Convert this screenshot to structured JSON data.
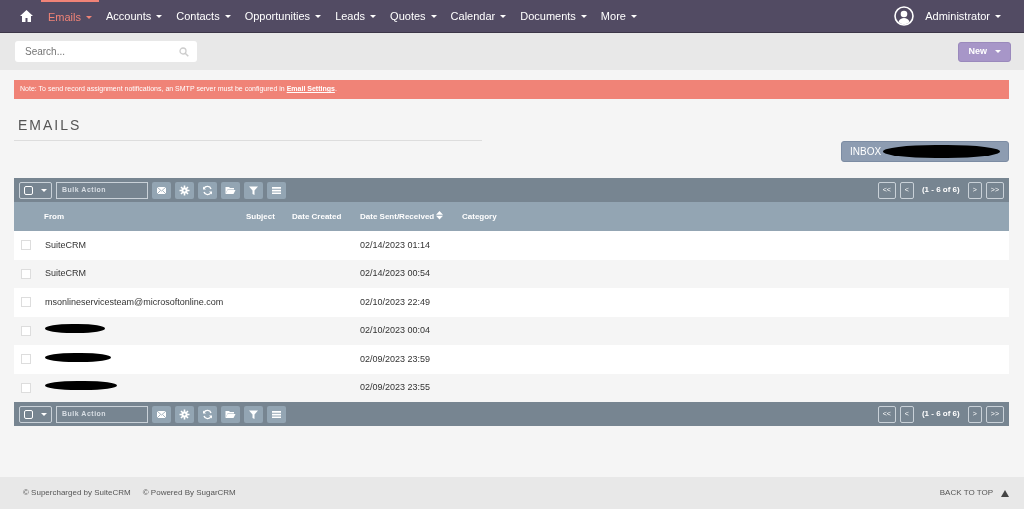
{
  "nav": {
    "items": [
      {
        "label": "Emails",
        "selected": true
      },
      {
        "label": "Accounts",
        "selected": false
      },
      {
        "label": "Contacts",
        "selected": false
      },
      {
        "label": "Opportunities",
        "selected": false
      },
      {
        "label": "Leads",
        "selected": false
      },
      {
        "label": "Quotes",
        "selected": false
      },
      {
        "label": "Calendar",
        "selected": false
      },
      {
        "label": "Documents",
        "selected": false
      },
      {
        "label": "More",
        "selected": false
      }
    ],
    "user": "Administrator"
  },
  "search": {
    "placeholder": "Search..."
  },
  "new_button": "New",
  "alert": {
    "text": "Note: To send record assignment notifications, an SMTP server must be configured in",
    "link": "Email Settings",
    "end": "."
  },
  "title": "EMAILS",
  "inbox": {
    "label": "INBOX",
    "redacted": true
  },
  "toolbars": [
    {
      "bulk_action": "Bulk Action",
      "pagination": {
        "first": "<<",
        "prev": "<",
        "range": "(1 - 6 of 6)",
        "next": ">",
        "last": ">>"
      }
    },
    {
      "bulk_action": "Bulk Action",
      "pagination": {
        "first": "<<",
        "prev": "<",
        "range": "(1 - 6 of 6)",
        "next": ">",
        "last": ">>"
      }
    }
  ],
  "table": {
    "columns": [
      "From",
      "Subject",
      "Date Created",
      "Date Sent/Received",
      "Category"
    ],
    "rows": [
      {
        "from": "SuiteCRM",
        "redacted": false,
        "date_sent": "02/14/2023 01:14",
        "checked": false
      },
      {
        "from": "SuiteCRM",
        "redacted": false,
        "date_sent": "02/14/2023 00:54",
        "checked": false
      },
      {
        "from": "msonlineservicesteam@microsoftonline.com",
        "redacted": false,
        "date_sent": "02/10/2023 22:49",
        "checked": false
      },
      {
        "redacted": true,
        "date_sent": "02/10/2023 00:04",
        "checked": false
      },
      {
        "redacted": true,
        "date_sent": "02/09/2023 23:59",
        "checked": false
      },
      {
        "redacted": true,
        "date_sent": "02/09/2023 23:55",
        "checked": false
      }
    ]
  },
  "footer": {
    "left": [
      "© Supercharged by SuiteCRM",
      "© Powered By SugarCRM"
    ],
    "back_to_top": "BACK TO TOP"
  }
}
